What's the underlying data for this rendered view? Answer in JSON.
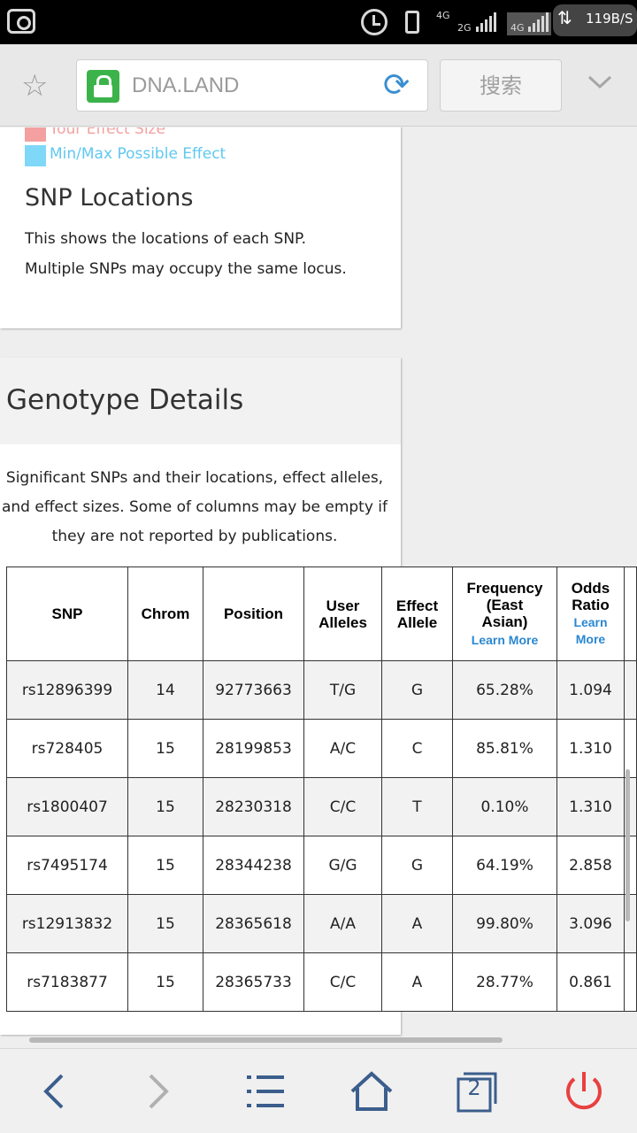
{
  "status_bar": {
    "network_top": "4G",
    "network_2g": "2G",
    "network_4g": "4G",
    "speed": "119B/S"
  },
  "browser": {
    "url": "DNA.LAND",
    "search_label": "搜索"
  },
  "legend": {
    "items": [
      {
        "label": "Your Effect Size",
        "color": "#f4a0a0"
      },
      {
        "label": "Min/Max Possible Effect",
        "color": "#80d8f8"
      }
    ]
  },
  "snp_locations": {
    "title": "SNP Locations",
    "line1": "This shows the locations of each SNP.",
    "line2": "Multiple SNPs may occupy the same locus."
  },
  "genotype": {
    "title": "Genotype Details",
    "description_lines": [
      "Significant SNPs and their locations, effect alleles,",
      "and effect sizes. Some of columns may be empty if",
      "they are not reported by publications."
    ]
  },
  "table": {
    "headers": {
      "snp": "SNP",
      "chrom": "Chrom",
      "position": "Position",
      "user_alleles_1": "User",
      "user_alleles_2": "Alleles",
      "effect_allele_1": "Effect",
      "effect_allele_2": "Allele",
      "frequency_1": "Frequency",
      "frequency_2": "(East",
      "frequency_3": "Asian)",
      "frequency_link": "Learn More",
      "odds_1": "Odds",
      "odds_2": "Ratio",
      "odds_link_1": "Learn",
      "odds_link_2": "More"
    },
    "rows": [
      {
        "snp": "rs12896399",
        "chrom": "14",
        "position": "92773663",
        "user_alleles": "T/G",
        "effect_allele": "G",
        "frequency": "65.28%",
        "odds": "1.094"
      },
      {
        "snp": "rs728405",
        "chrom": "15",
        "position": "28199853",
        "user_alleles": "A/C",
        "effect_allele": "C",
        "frequency": "85.81%",
        "odds": "1.310"
      },
      {
        "snp": "rs1800407",
        "chrom": "15",
        "position": "28230318",
        "user_alleles": "C/C",
        "effect_allele": "T",
        "frequency": "0.10%",
        "odds": "1.310"
      },
      {
        "snp": "rs7495174",
        "chrom": "15",
        "position": "28344238",
        "user_alleles": "G/G",
        "effect_allele": "G",
        "frequency": "64.19%",
        "odds": "2.858"
      },
      {
        "snp": "rs12913832",
        "chrom": "15",
        "position": "28365618",
        "user_alleles": "A/A",
        "effect_allele": "A",
        "frequency": "99.80%",
        "odds": "3.096"
      },
      {
        "snp": "rs7183877",
        "chrom": "15",
        "position": "28365733",
        "user_alleles": "C/C",
        "effect_allele": "A",
        "frequency": "28.77%",
        "odds": "0.861"
      }
    ]
  },
  "bottom_nav": {
    "tab_count": "2"
  }
}
